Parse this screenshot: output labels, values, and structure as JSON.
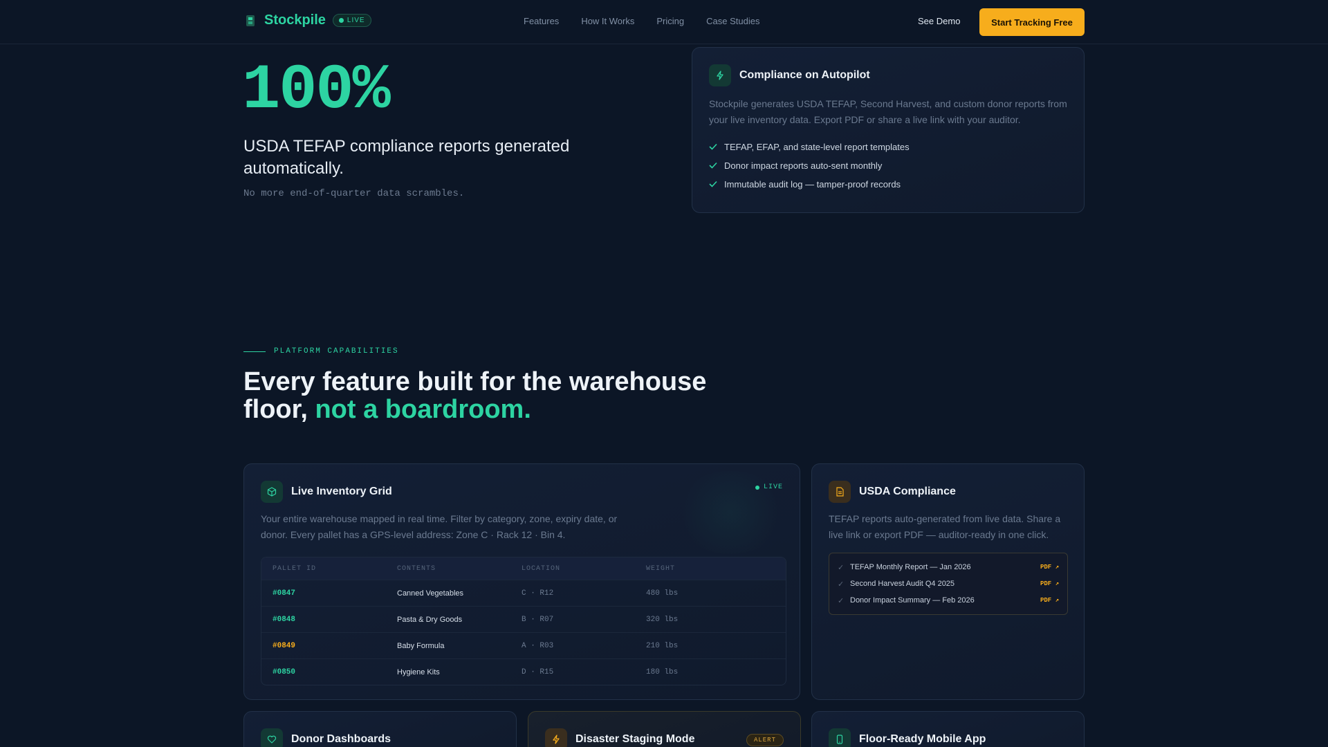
{
  "brand": {
    "name": "Stockpile",
    "live_label": "LIVE"
  },
  "nav": {
    "links": [
      "Features",
      "How It Works",
      "Pricing",
      "Case Studies"
    ],
    "see_demo": "See Demo",
    "cta": "Start Tracking Free"
  },
  "hero": {
    "stat": "100%",
    "headline": "USDA TEFAP compliance reports generated automatically.",
    "sub": "No more end-of-quarter data scrambles."
  },
  "compliance_card": {
    "title": "Compliance on Autopilot",
    "description": "Stockpile generates USDA TEFAP, Second Harvest, and custom donor reports from your live inventory data. Export PDF or share a live link with your auditor.",
    "items": [
      "TEFAP, EFAP, and state-level report templates",
      "Donor impact reports auto-sent monthly",
      "Immutable audit log — tamper-proof records"
    ]
  },
  "section": {
    "eyebrow": "PLATFORM CAPABILITIES",
    "title_main": "Every feature built for the warehouse floor,",
    "title_accent": "not a boardroom."
  },
  "inventory_card": {
    "title": "Live Inventory Grid",
    "live_label": "LIVE",
    "description": "Your entire warehouse mapped in real time. Filter by category, zone, expiry date, or donor. Every pallet has a GPS-level address: Zone C · Rack 12 · Bin 4.",
    "columns": [
      "PALLET ID",
      "CONTENTS",
      "LOCATION",
      "WEIGHT"
    ],
    "rows": [
      {
        "id": "#0847",
        "contents": "Canned Vegetables",
        "location": "C · R12",
        "weight": "480 lbs"
      },
      {
        "id": "#0848",
        "contents": "Pasta & Dry Goods",
        "location": "B · R07",
        "weight": "320 lbs"
      },
      {
        "id": "#0849",
        "contents": "Baby Formula",
        "location": "A · R03",
        "weight": "210 lbs"
      },
      {
        "id": "#0850",
        "contents": "Hygiene Kits",
        "location": "D · R15",
        "weight": "180 lbs"
      }
    ]
  },
  "usda_card": {
    "title": "USDA Compliance",
    "description": "TEFAP reports auto-generated from live data. Share a live link or export PDF — auditor-ready in one click.",
    "reports": [
      {
        "name": "TEFAP Monthly Report — Jan 2026",
        "link": "PDF ↗"
      },
      {
        "name": "Second Harvest Audit Q4 2025",
        "link": "PDF ↗"
      },
      {
        "name": "Donor Impact Summary — Feb 2026",
        "link": "PDF ↗"
      }
    ]
  },
  "bottom_cards": {
    "donor": {
      "title": "Donor Dashboards"
    },
    "disaster": {
      "title": "Disaster Staging Mode",
      "badge": "ALERT"
    },
    "mobile": {
      "title": "Floor-Ready Mobile App"
    }
  },
  "colors": {
    "accent": "#2dd4a2",
    "cta": "#f7ad1c",
    "background": "#0c1626"
  }
}
